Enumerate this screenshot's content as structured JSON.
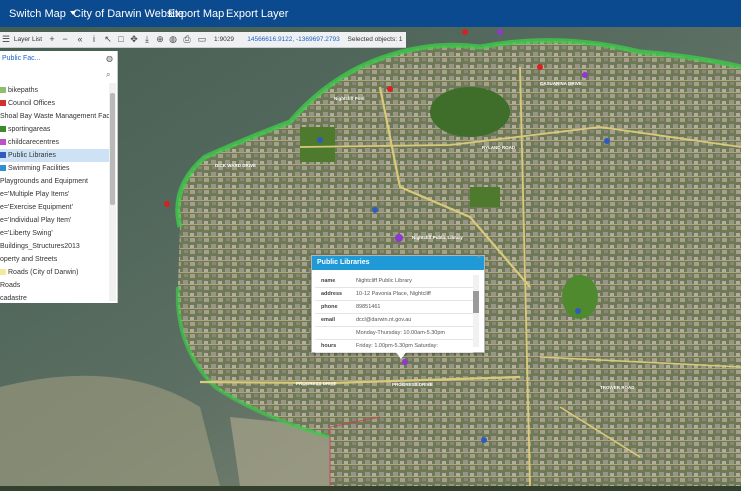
{
  "nav": {
    "switch_map": "Switch Map",
    "city_site": "City of Darwin Website",
    "export_map": "Export Map",
    "export_layer": "Export Layer"
  },
  "toolbar": {
    "layer_list_label": "Layer List",
    "scale": "1:9029",
    "coords": "14566616.9122, -1369697.2793",
    "selected": "Selected objects: 1"
  },
  "layer_panel": {
    "search_placeholder": "Public Fac...",
    "items": [
      {
        "label": "bikepaths",
        "swatch": "#8fbf6a"
      },
      {
        "label": "Council Offices",
        "swatch": "#d03030"
      },
      {
        "label": "Shoal Bay Waste Management Fac",
        "swatch": ""
      },
      {
        "label": "sportingareas",
        "swatch": "#3f8a2f"
      },
      {
        "label": "childcarecentres",
        "swatch": "#c050c8"
      },
      {
        "label": "Public Libraries",
        "swatch": "#2f5bbf"
      },
      {
        "label": "Swimming Facilities",
        "swatch": "#2f8fd0"
      },
      {
        "label": "Playgrounds and Equipment",
        "swatch": ""
      },
      {
        "label": "e='Multiple Play Items'",
        "swatch": ""
      },
      {
        "label": "e='Exercise Equipment'",
        "swatch": ""
      },
      {
        "label": "e='Individual Play Item'",
        "swatch": ""
      },
      {
        "label": "e='Liberty Swing'",
        "swatch": ""
      },
      {
        "label": "Buildings_Structures2013",
        "swatch": ""
      },
      {
        "label": "operty and Streets",
        "swatch": ""
      },
      {
        "label": "Roads (City of Darwin)",
        "swatch": "#f4e9a0"
      },
      {
        "label": "Roads",
        "swatch": ""
      },
      {
        "label": "cadastre",
        "swatch": ""
      }
    ],
    "selected_index": 5
  },
  "popup": {
    "title": "Public Libraries",
    "rows": [
      {
        "key": "name",
        "value": "Nightcliff Public Library"
      },
      {
        "key": "address",
        "value": "10-12 Pavonia Place, Nightcliff"
      },
      {
        "key": "phone",
        "value": "89851461"
      },
      {
        "key": "email",
        "value": "dccl@darwin.nt.gov.au"
      },
      {
        "key": "",
        "value": "Monday-Thursday: 10.00am-5.30pm"
      },
      {
        "key": "hours",
        "value": "Friday: 1.00pm-5.30pm Saturday:"
      }
    ]
  },
  "map_labels": {
    "progress_drive": "PROGRESS DRIVE",
    "rylance_road": "RYLAND ROAD",
    "casuarina_drive": "CASUARINA DRIVE",
    "dick_ward_drive": "DICK WARD DRIVE",
    "trower_road": "TROWER ROAD",
    "nightcliff_pool": "Nightcliff Pool",
    "library_marker_label": "Nightcliff Public Library"
  },
  "colors": {
    "nav_bg": "#0b4a8e",
    "popup_header": "#1f9ad6",
    "selected_row": "#cde3f5",
    "accent_link": "#1a63c8"
  }
}
